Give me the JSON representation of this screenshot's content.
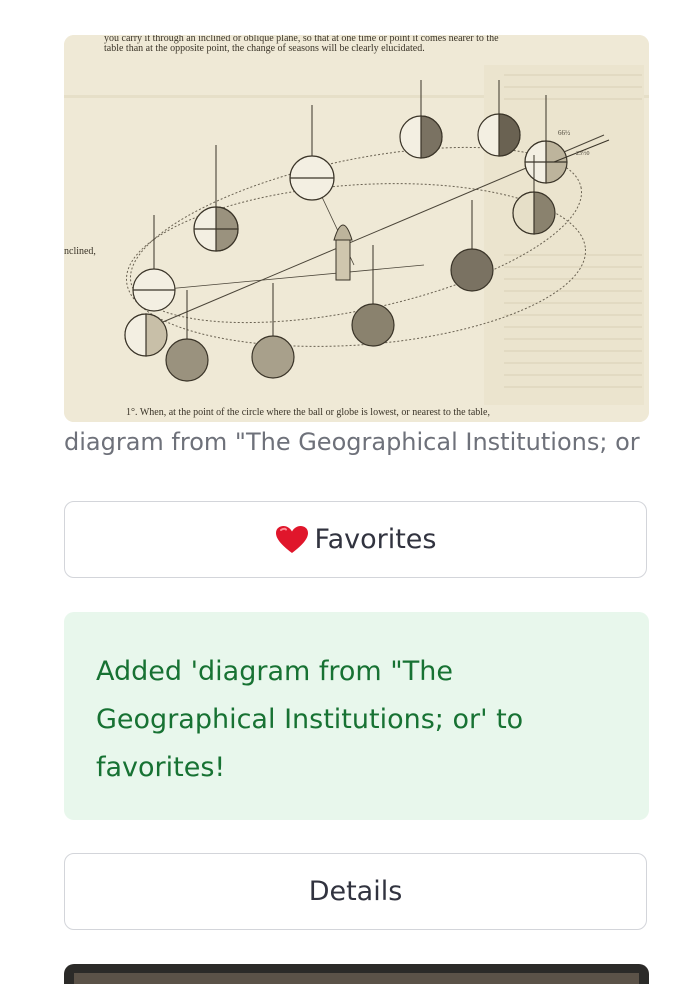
{
  "image": {
    "alt_icon": "engraving-seasons-diagram",
    "text_top_line1": "you carry it through an inclined or oblique plane, so that at one time or point it comes nearer to the",
    "text_top_line2": "table than at the opposite point, the change of seasons will be clearly elucidated.",
    "margin_word": "nclined,",
    "text_bottom": "1°. When, at the point of the circle where the ball or globe is lowest, or nearest to the table,",
    "fig_label_1": "66½",
    "fig_label_2": "23½0"
  },
  "caption": "diagram from \"The Geographical Institutions; or",
  "favorites_button": {
    "icon": "heart-icon",
    "label": "Favorites"
  },
  "success": {
    "message": "Added 'diagram from \"The Geographical Institutions; or' to favorites!"
  },
  "details_button": {
    "label": "Details"
  },
  "colors": {
    "success_bg": "#e8f7ec",
    "success_text": "#177233",
    "border": "#d3d5da",
    "caption": "#6e717a"
  }
}
